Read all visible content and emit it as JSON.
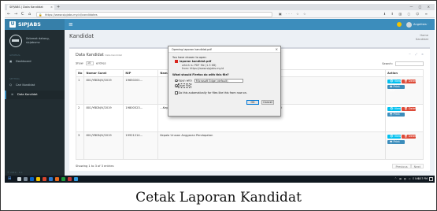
{
  "browser": {
    "tab_title": "SIPJABS | Data Kandidat",
    "tab_close": "×",
    "new_tab": "+",
    "window_controls": "— □ ×",
    "back": "←",
    "forward": "→",
    "reload": "C",
    "home": "⌂",
    "url": "https://www.sipjabs.my.id/candidates",
    "url_icons": "▣ ··· ☆ ☆",
    "right_icons": "⬇ ⦀ ▥ ◻ ☺ ≡"
  },
  "sidebar": {
    "brand": "SIPJABS",
    "brand_logo": "U",
    "user_name": "Selamat datang,",
    "user_role": "sicjabsmz",
    "section_general": "GENERAL",
    "dashboard": "Dashboard",
    "section_setting": "SETTING",
    "cari_kandidat": "Cari Kandidat",
    "data_kandidat": "Data Kandidat",
    "version": "© 2019 - 1.0"
  },
  "topnav": {
    "hamburger": "≡",
    "user": "Angelista ·"
  },
  "content": {
    "page_title": "Kandidat",
    "crumb_home": "Home",
    "crumb_current": "Kandidat",
    "box_title": "Data Kandidat",
    "box_subtitle": "Data Kandidat",
    "box_tools": "− ⤢ ×",
    "show_label": "Show",
    "show_value": "10",
    "entries_label": "entries",
    "search_label": "Search:"
  },
  "table": {
    "headers": [
      "No",
      "Nomor Surat",
      "NIP",
      "Nama",
      "Action"
    ],
    "rows": [
      {
        "no": "1",
        "surat": "801/YBDN/V/2019",
        "nip": "19650201...",
        "nama": "",
        "view": "👁 View",
        "del": "🗑 Delete",
        "print": "🖶 Print PDF"
      },
      {
        "no": "2",
        "surat": "801/YBDN/V/2019",
        "nip": "19800523...",
        "nama": "...Kepala Dinas Kependudukan dan Pencatatan Sipil ...Kabupaten dan Bupati Wonosari",
        "view": "👁 View",
        "del": "🗑 Delete",
        "print": "🖶 Print PDF"
      },
      {
        "no": "3",
        "surat": "801/YBDN/V/2019",
        "nip": "19921214...",
        "nama": "Kepala Urusan Anggaran Pendapatan",
        "view": "👁 View",
        "del": "🗑 Delete",
        "print": "🖶 Print PDF"
      }
    ],
    "info": "Showing 1 to 3 of 3 entries",
    "prev": "Previous",
    "next": "Next"
  },
  "dialog": {
    "title": "Opening laporan kandidat.pdf",
    "close": "×",
    "chosen_text": "You have chosen to open:",
    "file_name": "laporan kandidat.pdf",
    "file_type": "which is: PDF file (1.3 KB)",
    "file_from": "from: https://www.sipjabs.my.id",
    "question": "What should Firefox do with this file?",
    "open_with_label": "Open with",
    "open_with_app": "Microsoft Edge (default)",
    "save_label": "Save File",
    "auto_label": "Do this automatically for files like this from now on.",
    "ok": "OK",
    "cancel": "Cancel"
  },
  "taskbar": {
    "start": "⊞",
    "tray": "^ ▬ ◍ ◁ ENG",
    "time": "9:57 PM"
  },
  "caption": "Cetak Laporan Kandidat"
}
